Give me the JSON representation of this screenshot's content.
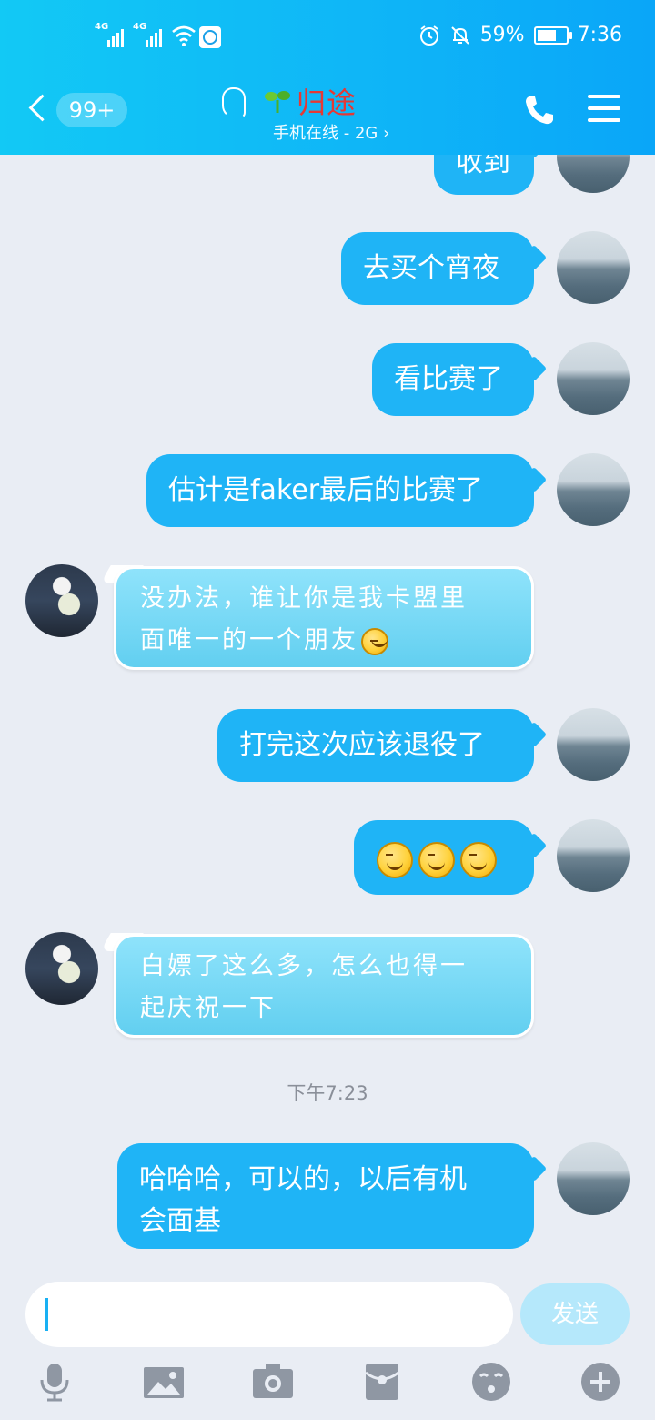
{
  "status_bar": {
    "network1": "4G",
    "network2": "4G",
    "battery": "59%",
    "time": "7:36"
  },
  "header": {
    "unread_badge": "99+",
    "contact_name": "归途",
    "contact_status": "手机在线 - 2G",
    "chevron": "›"
  },
  "messages": [
    {
      "side": "me",
      "text": "收到"
    },
    {
      "side": "me",
      "text": "去买个宵夜"
    },
    {
      "side": "me",
      "text": "看比赛了"
    },
    {
      "side": "me",
      "text": "估计是faker最后的比赛了"
    },
    {
      "side": "them",
      "line1": "没办法，谁让你是我卡盟里",
      "line2": "面唯一的一个朋友",
      "trailing_emoji": "smile-emoji"
    },
    {
      "side": "me",
      "text": "打完这次应该退役了"
    },
    {
      "side": "me",
      "emojis": [
        "smirk-emoji",
        "smirk-emoji",
        "smirk-emoji"
      ]
    },
    {
      "side": "them",
      "line1": "白嫖了这么多，怎么也得一",
      "line2": "起庆祝一下"
    },
    {
      "side": "me",
      "line1": "哈哈哈，可以的，以后有机",
      "line2": "会面基"
    }
  ],
  "timestamp": "下午7:23",
  "composer": {
    "send_label": "发送"
  },
  "toolbar_icons": [
    "microphone-icon",
    "image-icon",
    "camera-icon",
    "red-packet-icon",
    "emoji-icon",
    "plus-icon"
  ],
  "colors": {
    "header_blue": "#0fb6f7",
    "my_bubble": "#1fb4f6",
    "their_bubble": "#62cff0",
    "contact_name": "#e53935",
    "background": "#e9edf4",
    "send_button": "#b5e8fb"
  }
}
